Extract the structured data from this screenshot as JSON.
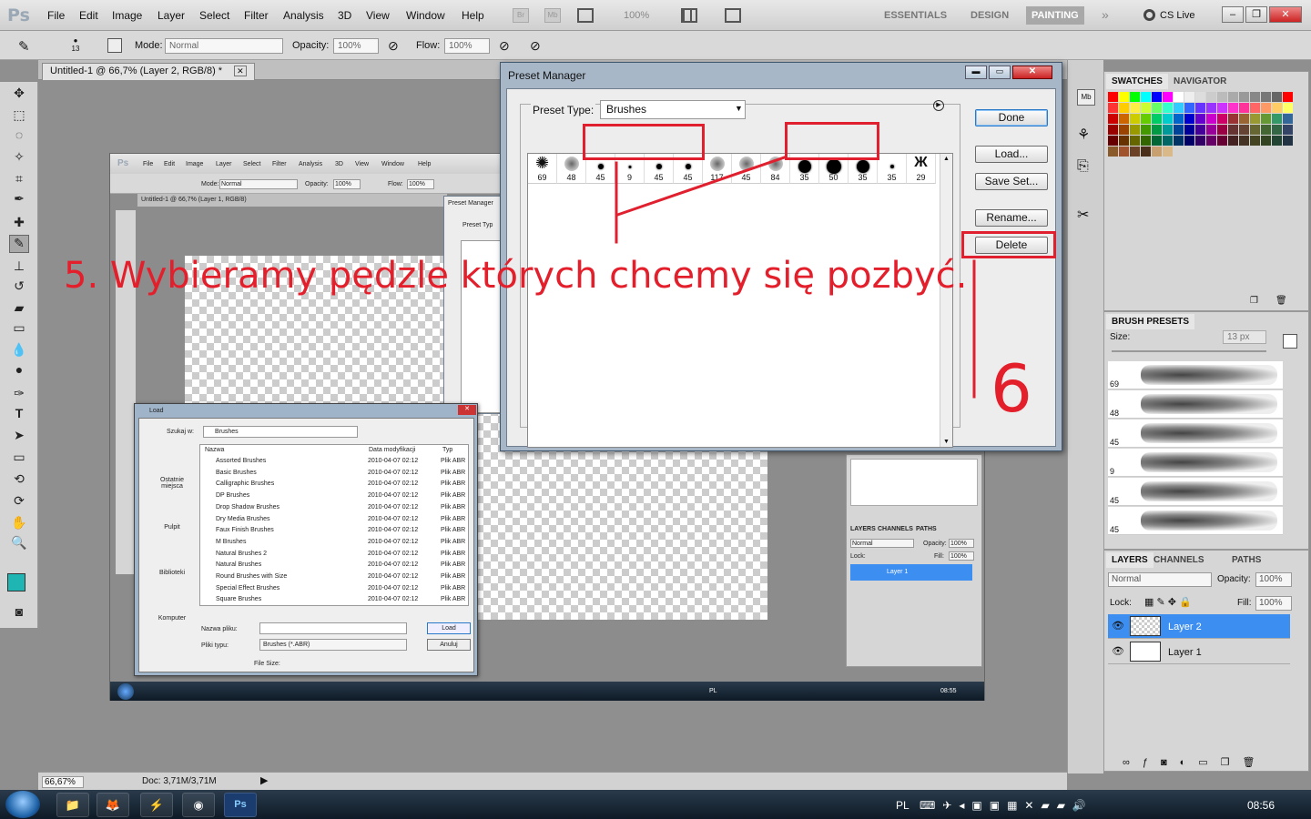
{
  "app": {
    "logo": "Ps",
    "menu": [
      "File",
      "Edit",
      "Image",
      "Layer",
      "Select",
      "Filter",
      "Analysis",
      "3D",
      "View",
      "Window",
      "Help"
    ],
    "zoom_field": "100%",
    "workspaces": [
      "ESSENTIALS",
      "DESIGN",
      "PAINTING"
    ],
    "active_workspace": "PAINTING",
    "cs_live": "CS Live"
  },
  "options_bar": {
    "brush_size": "13",
    "mode_label": "Mode:",
    "mode_value": "Normal",
    "opacity_label": "Opacity:",
    "opacity_value": "100%",
    "flow_label": "Flow:",
    "flow_value": "100%"
  },
  "document": {
    "tab_title": "Untitled-1 @ 66,7% (Layer 2, RGB/8) *",
    "status_zoom": "66,67%",
    "status_doc": "Doc: 3,71M/3,71M"
  },
  "preset_manager": {
    "title": "Preset Manager",
    "preset_type_label": "Preset Type:",
    "preset_type_value": "Brushes",
    "buttons": {
      "done": "Done",
      "load": "Load...",
      "save_set": "Save Set...",
      "rename": "Rename...",
      "delete": "Delete"
    },
    "brushes": [
      {
        "size": "69",
        "kind": "star"
      },
      {
        "size": "48",
        "kind": "soft"
      },
      {
        "size": "45",
        "kind": "dot",
        "d": 6
      },
      {
        "size": "9",
        "kind": "dot",
        "d": 3
      },
      {
        "size": "45",
        "kind": "dot",
        "d": 6
      },
      {
        "size": "45",
        "kind": "dot",
        "d": 6
      },
      {
        "size": "117",
        "kind": "soft"
      },
      {
        "size": "45",
        "kind": "soft"
      },
      {
        "size": "84",
        "kind": "soft"
      },
      {
        "size": "35",
        "kind": "dot",
        "d": 14
      },
      {
        "size": "50",
        "kind": "dot",
        "d": 16
      },
      {
        "size": "35",
        "kind": "dot",
        "d": 14
      },
      {
        "size": "35",
        "kind": "dot",
        "d": 4
      },
      {
        "size": "29",
        "kind": "butterfly"
      }
    ]
  },
  "annotations": {
    "step5": "5. Wybieramy pędzle których chcemy się pozbyć.",
    "step6": "6"
  },
  "swatches": {
    "tabs": [
      "SWATCHES",
      "NAVIGATOR"
    ],
    "colors": [
      "#ff0000",
      "#ffff00",
      "#00ff00",
      "#00ffff",
      "#0000ff",
      "#ff00ff",
      "#ffffff",
      "#eeeeee",
      "#dddddd",
      "#cccccc",
      "#bbbbbb",
      "#aaaaaa",
      "#999999",
      "#888888",
      "#777777",
      "#666666",
      "#ff0000",
      "#ff3333",
      "#ffcc00",
      "#ffee44",
      "#ccff33",
      "#66ff66",
      "#33ffcc",
      "#33ccff",
      "#3366ff",
      "#6633ff",
      "#9933ff",
      "#cc33ff",
      "#ff33cc",
      "#ff3399",
      "#ff6666",
      "#ff9966",
      "#ffcc66",
      "#ffff66",
      "#cc0000",
      "#cc6600",
      "#cccc00",
      "#66cc00",
      "#00cc66",
      "#00cccc",
      "#0066cc",
      "#0000cc",
      "#6600cc",
      "#cc00cc",
      "#cc0066",
      "#993333",
      "#996633",
      "#999933",
      "#669933",
      "#339966",
      "#336699",
      "#990000",
      "#994400",
      "#999900",
      "#449900",
      "#009944",
      "#009999",
      "#004499",
      "#000099",
      "#440099",
      "#990099",
      "#990044",
      "#663333",
      "#664433",
      "#666633",
      "#446633",
      "#336644",
      "#334466",
      "#660000",
      "#663300",
      "#666600",
      "#336600",
      "#006633",
      "#006666",
      "#003366",
      "#000066",
      "#330066",
      "#660066",
      "#660033",
      "#442222",
      "#443322",
      "#444422",
      "#334422",
      "#224433",
      "#223344",
      "#8b5a2b",
      "#a0522d",
      "#6b4226",
      "#4a2f1a",
      "#c8a070",
      "#d9b98a"
    ]
  },
  "brush_presets": {
    "title": "BRUSH PRESETS",
    "size_label": "Size:",
    "size_value": "13 px",
    "rows": [
      "69",
      "48",
      "45",
      "9",
      "45",
      "45"
    ]
  },
  "layers": {
    "tabs": [
      "LAYERS",
      "CHANNELS",
      "PATHS"
    ],
    "blend_mode": "Normal",
    "opacity_label": "Opacity:",
    "opacity_value": "100%",
    "lock_label": "Lock:",
    "fill_label": "Fill:",
    "fill_value": "100%",
    "items": [
      "Layer 2",
      "Layer 1"
    ],
    "selected": "Layer 2"
  },
  "taskbar": {
    "lang": "PL",
    "clock": "08:56"
  },
  "inner_screenshot": {
    "tab_title": "Untitled-1 @ 66,7% (Layer 1, RGB/8)",
    "preset_title": "Preset Manager",
    "preset_type_label": "Preset Typ",
    "load_title": "Load",
    "look_in_label": "Szukaj w:",
    "look_in_value": "Brushes",
    "places": [
      "Ostatnie miejsca",
      "Pulpit",
      "Biblioteki",
      "Komputer"
    ],
    "columns": [
      "Nazwa",
      "Data modyfikacji",
      "Typ"
    ],
    "files": [
      "Assorted Brushes",
      "Basic Brushes",
      "Calligraphic Brushes",
      "DP Brushes",
      "Drop Shadow Brushes",
      "Dry Media Brushes",
      "Faux Finish Brushes",
      "M Brushes",
      "Natural Brushes 2",
      "Natural Brushes",
      "Round Brushes with Size",
      "Special Effect Brushes",
      "Square Brushes"
    ],
    "file_date": "2010-04-07 02:12",
    "file_type": "Plik ABR",
    "filename_label": "Nazwa pliku:",
    "filetype_label": "Pliki typu:",
    "filetype_value": "Brushes (*.ABR)",
    "file_size_label": "File Size:",
    "load_btn": "Load",
    "cancel_btn": "Anuluj",
    "layer_item": "Layer 1",
    "clock": "08:55",
    "lang": "PL"
  }
}
